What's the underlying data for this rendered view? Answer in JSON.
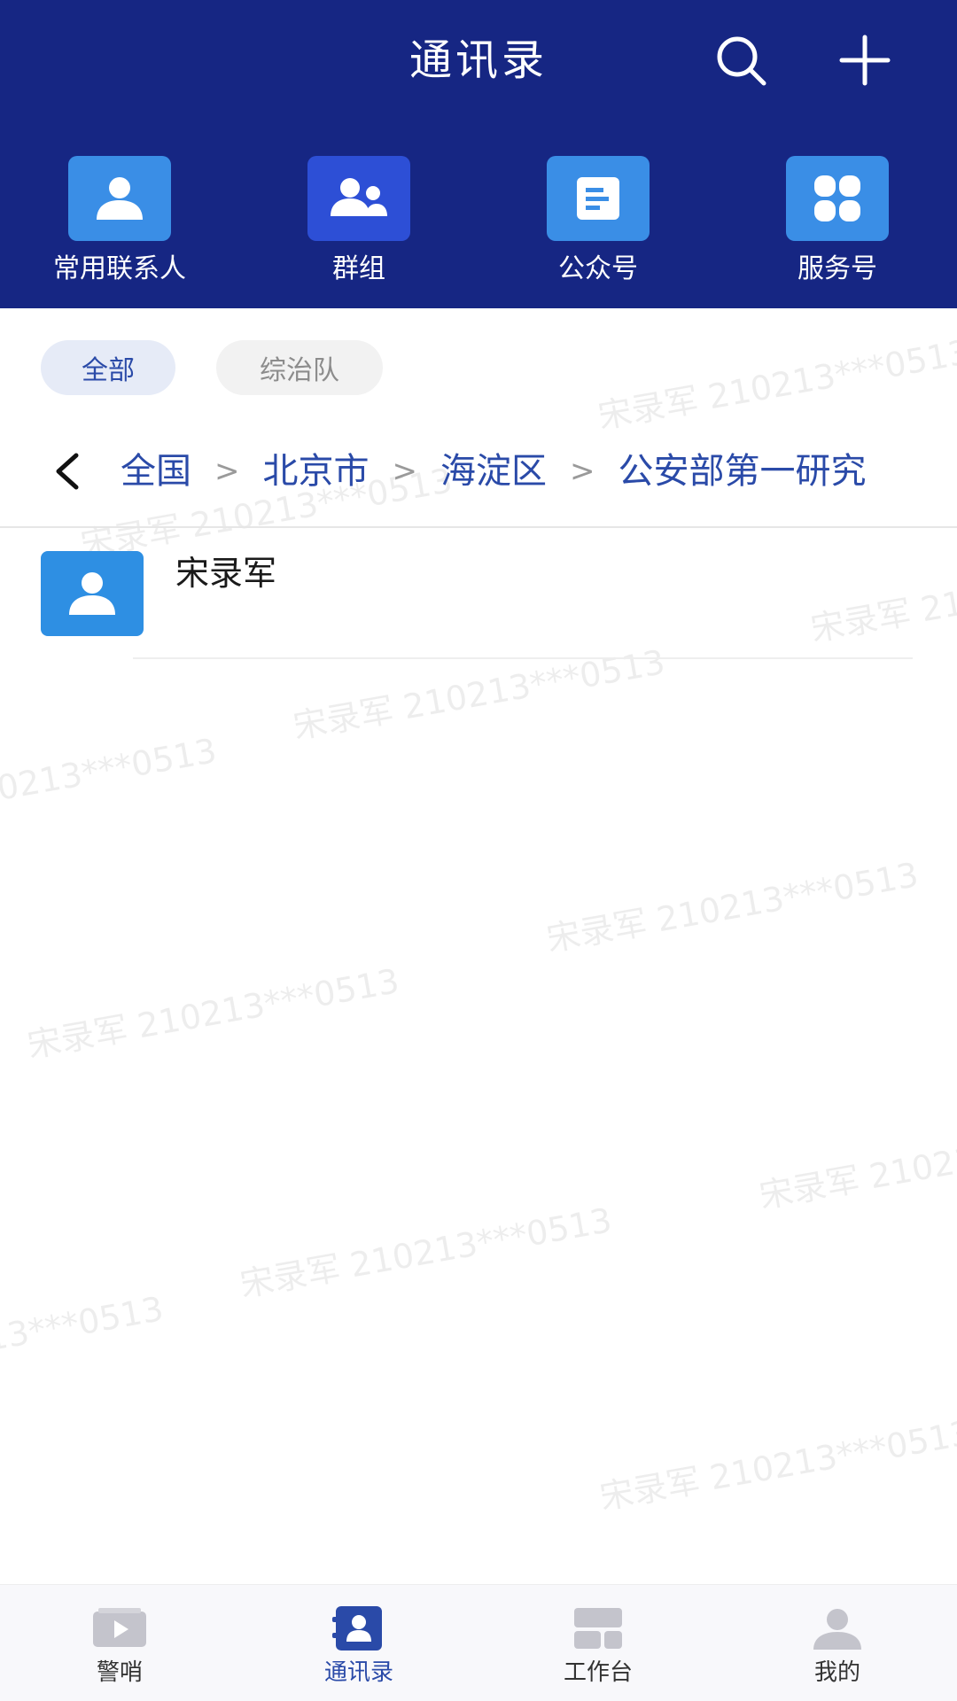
{
  "header": {
    "title": "通讯录",
    "icons": {
      "search": "search-icon",
      "add": "plus-icon"
    }
  },
  "quick_access": [
    {
      "label": "常用联系人",
      "icon": "person-icon",
      "color": "#3a8ee6"
    },
    {
      "label": "群组",
      "icon": "group-icon",
      "color": "#2d4fd6"
    },
    {
      "label": "公众号",
      "icon": "document-icon",
      "color": "#3a8ee6"
    },
    {
      "label": "服务号",
      "icon": "grid-icon",
      "color": "#3a8ee6"
    }
  ],
  "filters": [
    {
      "label": "全部",
      "active": true
    },
    {
      "label": "综治队",
      "active": false
    }
  ],
  "breadcrumb": {
    "items": [
      "全国",
      "北京市",
      "海淀区",
      "公安部第一研究"
    ],
    "separator": ">"
  },
  "contacts": [
    {
      "name": "宋录军",
      "icon": "person-icon"
    }
  ],
  "watermark_text": "宋录军 210213***0513",
  "bottom_nav": [
    {
      "label": "警哨",
      "icon": "video-icon",
      "active": false
    },
    {
      "label": "通讯录",
      "icon": "contacts-icon",
      "active": true
    },
    {
      "label": "工作台",
      "icon": "workbench-icon",
      "active": false
    },
    {
      "label": "我的",
      "icon": "profile-icon",
      "active": false
    }
  ],
  "colors": {
    "header_bg": "#162683",
    "accent": "#2a4aa8",
    "tile_blue": "#3a8ee6",
    "tile_indigo": "#2d4fd6"
  }
}
